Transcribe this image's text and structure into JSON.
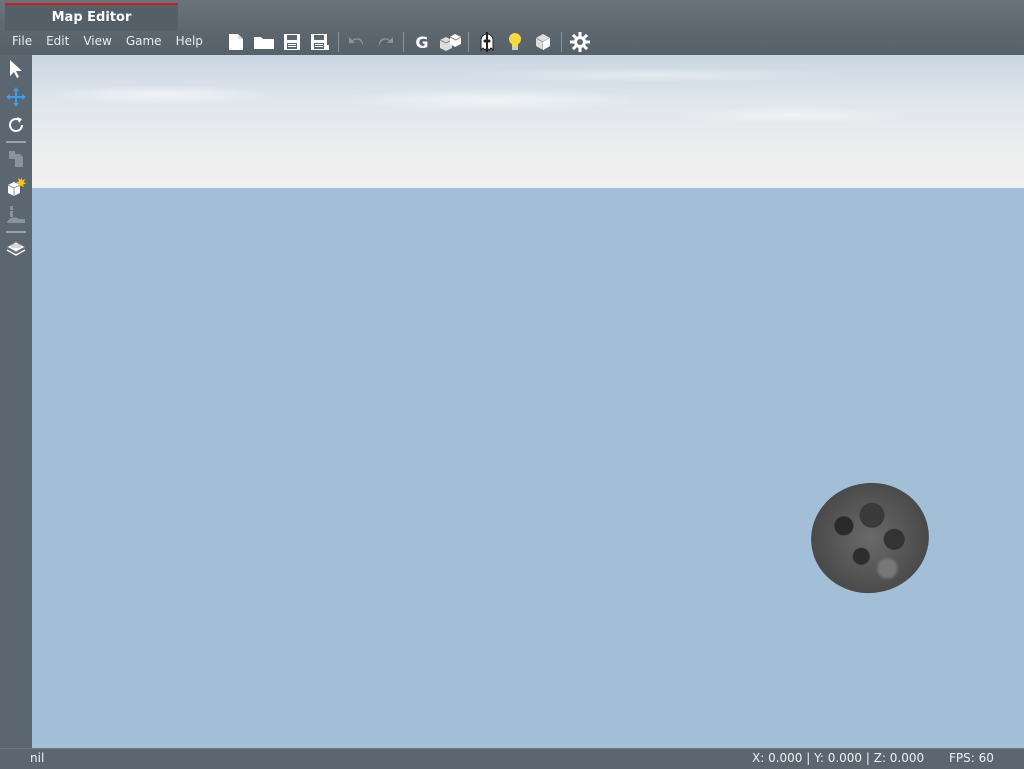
{
  "window": {
    "title": "Map Editor",
    "accent": "#c8211d"
  },
  "menu": [
    "File",
    "Edit",
    "View",
    "Game",
    "Help"
  ],
  "toolbar_icons": [
    "new-file-icon",
    "open-folder-icon",
    "save-icon",
    "save-as-icon",
    "undo-icon",
    "redo-icon",
    "gravity-g-icon",
    "objects-icon",
    "ghost-icon",
    "lightbulb-icon",
    "cube-icon",
    "gear-icon"
  ],
  "left_tools": [
    "select-arrow-icon",
    "move-arrows-icon",
    "rotate-icon",
    "element-browser-icon",
    "create-object-icon",
    "player-spawn-icon",
    "map-layers-icon"
  ],
  "status": {
    "left": "nil",
    "coords": "X: 0.000 | Y: 0.000 | Z: 0.000",
    "fps": "FPS:  60"
  }
}
